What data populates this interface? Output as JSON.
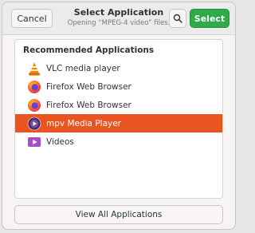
{
  "header": {
    "title": "Select Application",
    "subtitle": "Opening “MPEG-4 video” files.",
    "cancel_label": "Cancel",
    "select_label": "Select",
    "search_icon": "search-icon"
  },
  "list": {
    "section_title": "Recommended Applications",
    "items": [
      {
        "label": "VLC media player",
        "icon": "vlc-icon",
        "selected": false
      },
      {
        "label": "Firefox Web Browser",
        "icon": "firefox-icon",
        "selected": false
      },
      {
        "label": "Firefox Web Browser",
        "icon": "firefox-icon",
        "selected": false
      },
      {
        "label": "mpv Media Player",
        "icon": "mpv-icon",
        "selected": true
      },
      {
        "label": "Videos",
        "icon": "videos-icon",
        "selected": false
      }
    ]
  },
  "footer": {
    "view_all_label": "View All Applications"
  },
  "colors": {
    "accent_select": "#e95420",
    "suggested_button": "#2eab48"
  }
}
